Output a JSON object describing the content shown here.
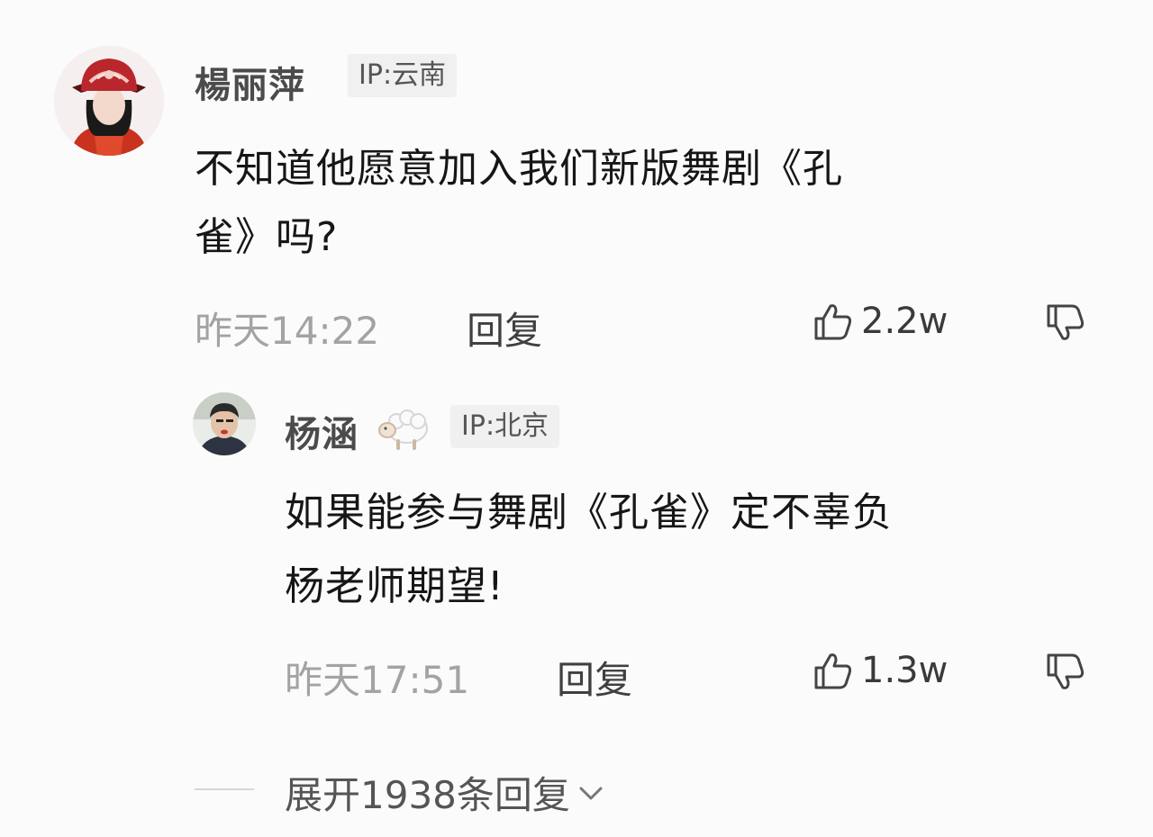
{
  "comment": {
    "username": "楊丽萍",
    "ip": "IP:云南",
    "text_line1": "不知道他愿意加入我们新版舞剧《孔",
    "text_line2": "雀》吗?",
    "time": "昨天14:22",
    "reply_label": "回复",
    "likes": "2.2w"
  },
  "reply": {
    "username": "杨涵",
    "badge_icon": "sheep-icon",
    "ip": "IP:北京",
    "text_line1": "如果能参与舞剧《孔雀》定不辜负",
    "text_line2": "杨老师期望!",
    "time": "昨天17:51",
    "reply_label": "回复",
    "likes": "1.3w"
  },
  "expand": {
    "label": "展开1938条回复"
  },
  "colors": {
    "background": "#fbfbfb",
    "username": "#4b4b4b",
    "meta": "#a3a3a3"
  }
}
